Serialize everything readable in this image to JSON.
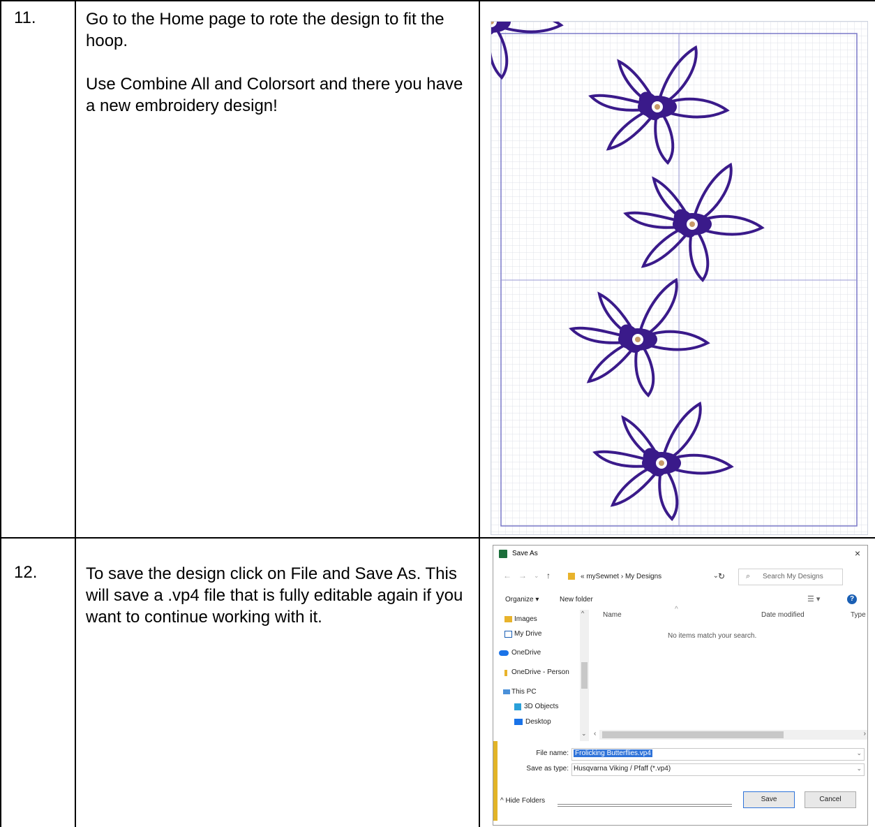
{
  "rows": [
    {
      "number": "11.",
      "paragraphs": [
        "Go to the Home page to rote the design to fit the hoop.",
        "Use Combine All and Colorsort and there you have a new embroidery design!"
      ]
    },
    {
      "number": "12.",
      "paragraphs": [
        "To save the design click on File and Save As. This will save a .vp4 file that is fully editable again if you want to continue working with it."
      ]
    }
  ],
  "hoop_image": {
    "grid": true,
    "design_color": "#3a1a8a",
    "center_color": "#c79a6a"
  },
  "dialog": {
    "title": "Save As",
    "close": "×",
    "path_prefix": "«",
    "path_folder": "mySewnet",
    "path_separator": "›",
    "path_current": "My Designs",
    "search_placeholder": "Search My Designs",
    "organize": "Organize ▾",
    "new_folder": "New folder",
    "help": "?",
    "nav_items": [
      "Images",
      "My Drive",
      "OneDrive",
      "OneDrive - Person",
      "This PC",
      "3D Objects",
      "Desktop"
    ],
    "columns": [
      "Name",
      "Date modified",
      "Type"
    ],
    "empty_message": "No items match your search.",
    "file_name_label": "File name:",
    "file_name": "Frolicking Butterflies.vp4",
    "save_type_label": "Save as type:",
    "save_type": "Husqvarna Viking / Pfaff (*.vp4)",
    "hide_folders": "Hide Folders",
    "save": "Save",
    "cancel": "Cancel"
  }
}
